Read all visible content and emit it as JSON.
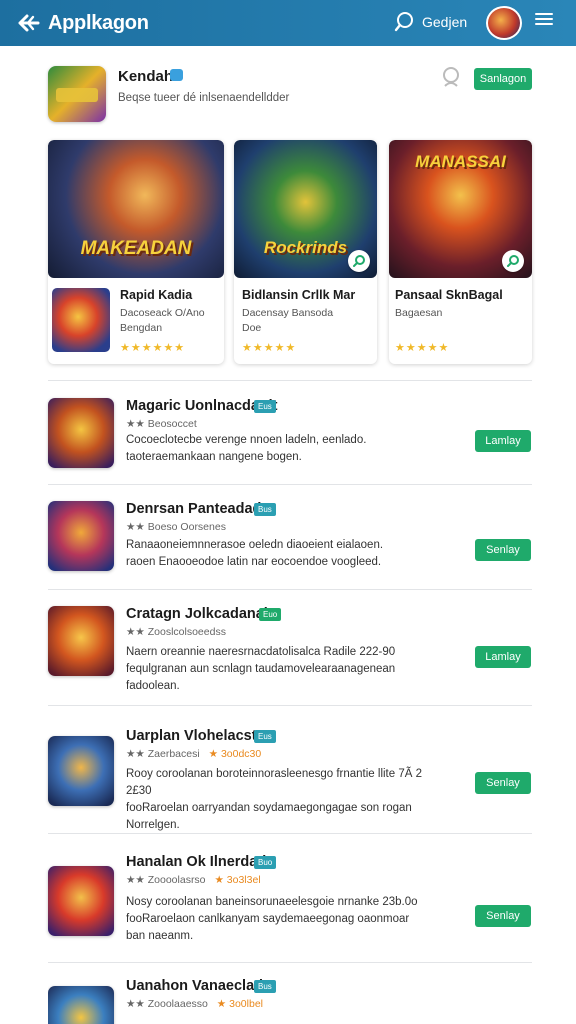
{
  "header": {
    "title": "Applkagon",
    "search_label": "Gedjen"
  },
  "featured": {
    "name": "Kendah",
    "description": "Beqse tueer dé inlsenaendelldder",
    "action_label": "Sanlagon"
  },
  "cards": [
    {
      "art_title": "MAKEADAN",
      "title": "Rapid Kadia",
      "subtitle": [
        "Dacoseack O/Ano",
        "Bengdan"
      ],
      "stars": "★★★★★★"
    },
    {
      "art_title": "Rockrinds",
      "title": "Bidlansin Crllk Mar",
      "subtitle": [
        "Dacensay Bansoda",
        "Doe"
      ],
      "stars": "★★★★★"
    },
    {
      "art_title": "MANASSAI",
      "title": "Pansaal SknBagal",
      "subtitle": [
        "Bagaesan"
      ],
      "stars": "★★★★★"
    }
  ],
  "list": [
    {
      "title": "Magaric Uonlnacdatdt",
      "tag": "Eus",
      "meta": "★★ Beosoccet",
      "meta_extra": "",
      "description": [
        "Cocoeclotecbe verenge nnoen ladeln, eenlado.",
        "taoteraemankaan nangene bogen."
      ],
      "action_label": "Lamlay"
    },
    {
      "title": "Denrsan Panteadadr",
      "tag": "Bus",
      "meta": "★★ Boeso Oorsenes",
      "meta_extra": "",
      "description": [
        "Ranaaoneiemnnerasoe oeledn diaoeient eialaoen.",
        "raoen Enaooeodoe latin nar eocoendoe voogleed."
      ],
      "action_label": "Senlay"
    },
    {
      "title": "Cratagn Jolkcadanah",
      "tag": "Euo",
      "meta": "★★ Zooslcolsoeedss",
      "meta_extra": "",
      "description": [
        "Naern oreannie naeresrnacdatolisalca Radile 222-90",
        "fequlgranan aun scnlagn taudamovelearaanagenean",
        "fadoolean."
      ],
      "action_label": "Lamlay"
    },
    {
      "title": "Uarplan Vlohelacsta",
      "tag": "Eus",
      "meta": "★★ Zaerbacesi",
      "meta_extra": "★ 3o0dc30",
      "description": [
        "Rooy coroolanan boroteinnorasleenesgo frnantie llite 7Ã 2 2£30",
        "fooRaroelan oarryandan soydamaegongagae son rogan",
        "Norrelgen."
      ],
      "action_label": "Senlay"
    },
    {
      "title": "Hanalan Ok Ilnerdada",
      "tag": "Buo",
      "meta": "★★ Zoooolasrso",
      "meta_extra": "★ 3o3l3el",
      "description": [
        "Nosy coroolanan baneinsorunaeelesgoie nrnanke 23b.0o",
        "fooRaroelaon canlkanyam saydemaeegonag oaonmoar",
        "ban naeanm."
      ],
      "action_label": "Senlay"
    },
    {
      "title": "Uanahon Vanaeclad2",
      "tag": "Bus",
      "meta": "★★ Zooolaaesso",
      "meta_extra": "★ 3o0lbel",
      "description": [],
      "action_label": ""
    }
  ]
}
